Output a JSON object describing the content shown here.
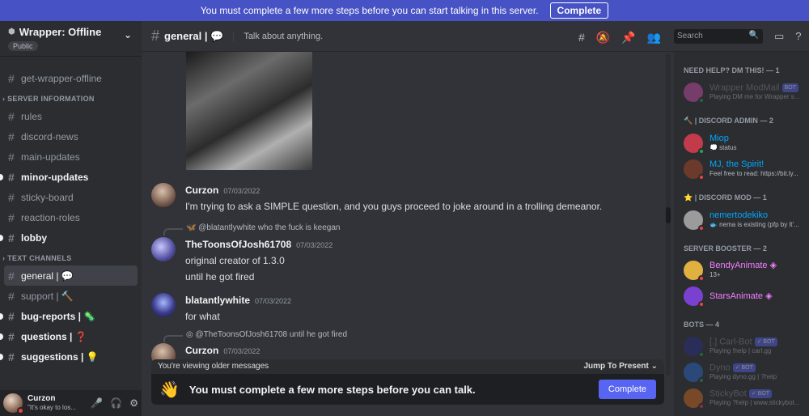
{
  "banner": {
    "text": "You must complete a few more steps before you can start talking in this server.",
    "button": "Complete"
  },
  "server": {
    "name": "Wrapper: Offline",
    "badge": "Public"
  },
  "channels_top": [
    {
      "label": "get-wrapper-offline",
      "unread": false
    }
  ],
  "categories": [
    {
      "label": "SERVER INFORMATION",
      "channels": [
        {
          "label": "rules",
          "unread": false
        },
        {
          "label": "discord-news",
          "unread": false
        },
        {
          "label": "main-updates",
          "unread": false
        },
        {
          "label": "minor-updates",
          "unread": true
        },
        {
          "label": "sticky-board",
          "unread": false
        },
        {
          "label": "reaction-roles",
          "unread": false
        },
        {
          "label": "lobby",
          "unread": true
        }
      ]
    },
    {
      "label": "TEXT CHANNELS",
      "channels": [
        {
          "label": "general | 💬",
          "unread": false,
          "active": true
        },
        {
          "label": "support | 🔨",
          "unread": false
        },
        {
          "label": "bug-reports | 🦠",
          "unread": true
        },
        {
          "label": "questions | ❓",
          "unread": true
        },
        {
          "label": "suggestions | 💡",
          "unread": true
        }
      ]
    }
  ],
  "user": {
    "name": "Curzon",
    "status": "\"It's okay to los..."
  },
  "chat": {
    "title": "general | 💬",
    "topic": "Talk about anything.",
    "messages": [
      {
        "author": "Curzon",
        "time": "07/03/2022",
        "text": "I'm trying to ask a SIMPLE question, and you guys proceed to joke around in a trolling demeanor."
      },
      {
        "reply_author": "@blatantlywhite",
        "reply_text": "who the fuck is keegan",
        "author": "TheToonsOfJosh61708",
        "time": "07/03/2022",
        "text": "original creator of 1.3.0",
        "text2": "until he got fired"
      },
      {
        "author": "blatantlywhite",
        "time": "07/03/2022",
        "text": "for what"
      },
      {
        "reply_author": "@TheToonsOfJosh61708",
        "reply_text": "until he got fired",
        "author": "Curzon",
        "time": "07/03/2022"
      }
    ],
    "older_text": "You're viewing older messages",
    "jump_text": "Jump To Present",
    "gate_text": "You must complete a few more steps before you can talk.",
    "gate_button": "Complete"
  },
  "search": {
    "placeholder": "Search"
  },
  "members": {
    "groups": [
      {
        "label": "NEED HELP? DM THIS! — 1",
        "items": [
          {
            "name": "Wrapper ModMail",
            "bot": "BOT",
            "sub": "Playing DM me for Wrapper s...",
            "color": "#80848e",
            "status": "on",
            "dim": true
          }
        ]
      },
      {
        "label": "🔨 | DISCORD ADMIN — 2",
        "items": [
          {
            "name": "Miop",
            "sub": "💭 status",
            "color": "#00a8fc",
            "status": "on"
          },
          {
            "name": "MJ, the Spirit!",
            "sub": "Feel free to read: https://bit.ly...",
            "color": "#00a8fc",
            "status": "busy"
          }
        ]
      },
      {
        "label": "⭐ | DISCORD MOD — 1",
        "items": [
          {
            "name": "nemertodekiko",
            "sub": "🐟 nema is existing (pfp by lt'...",
            "color": "#00a8fc",
            "status": "busy"
          }
        ]
      },
      {
        "label": "SERVER BOOSTER — 2",
        "items": [
          {
            "name": "BendyAnimate ◈",
            "sub": "13+",
            "color": "#f47fff",
            "status": "busy"
          },
          {
            "name": "StarsAnimate ◈",
            "sub": "",
            "color": "#f47fff",
            "status": "busy"
          }
        ]
      },
      {
        "label": "BOTS — 4",
        "items": [
          {
            "name": "[.] Carl-Bot",
            "bot": "✓ BOT",
            "sub": "Playing !help | carl.gg",
            "color": "#80848e",
            "status": "on",
            "dim": true
          },
          {
            "name": "Dyno",
            "bot": "✓ BOT",
            "sub": "Playing dyno.gg | ?help",
            "color": "#80848e",
            "status": "on",
            "dim": true
          },
          {
            "name": "StickyBot",
            "bot": "✓ BOT",
            "sub": "Playing ?help | www.stickybot...",
            "color": "#80848e",
            "status": "busy",
            "dim": true
          }
        ]
      }
    ]
  }
}
